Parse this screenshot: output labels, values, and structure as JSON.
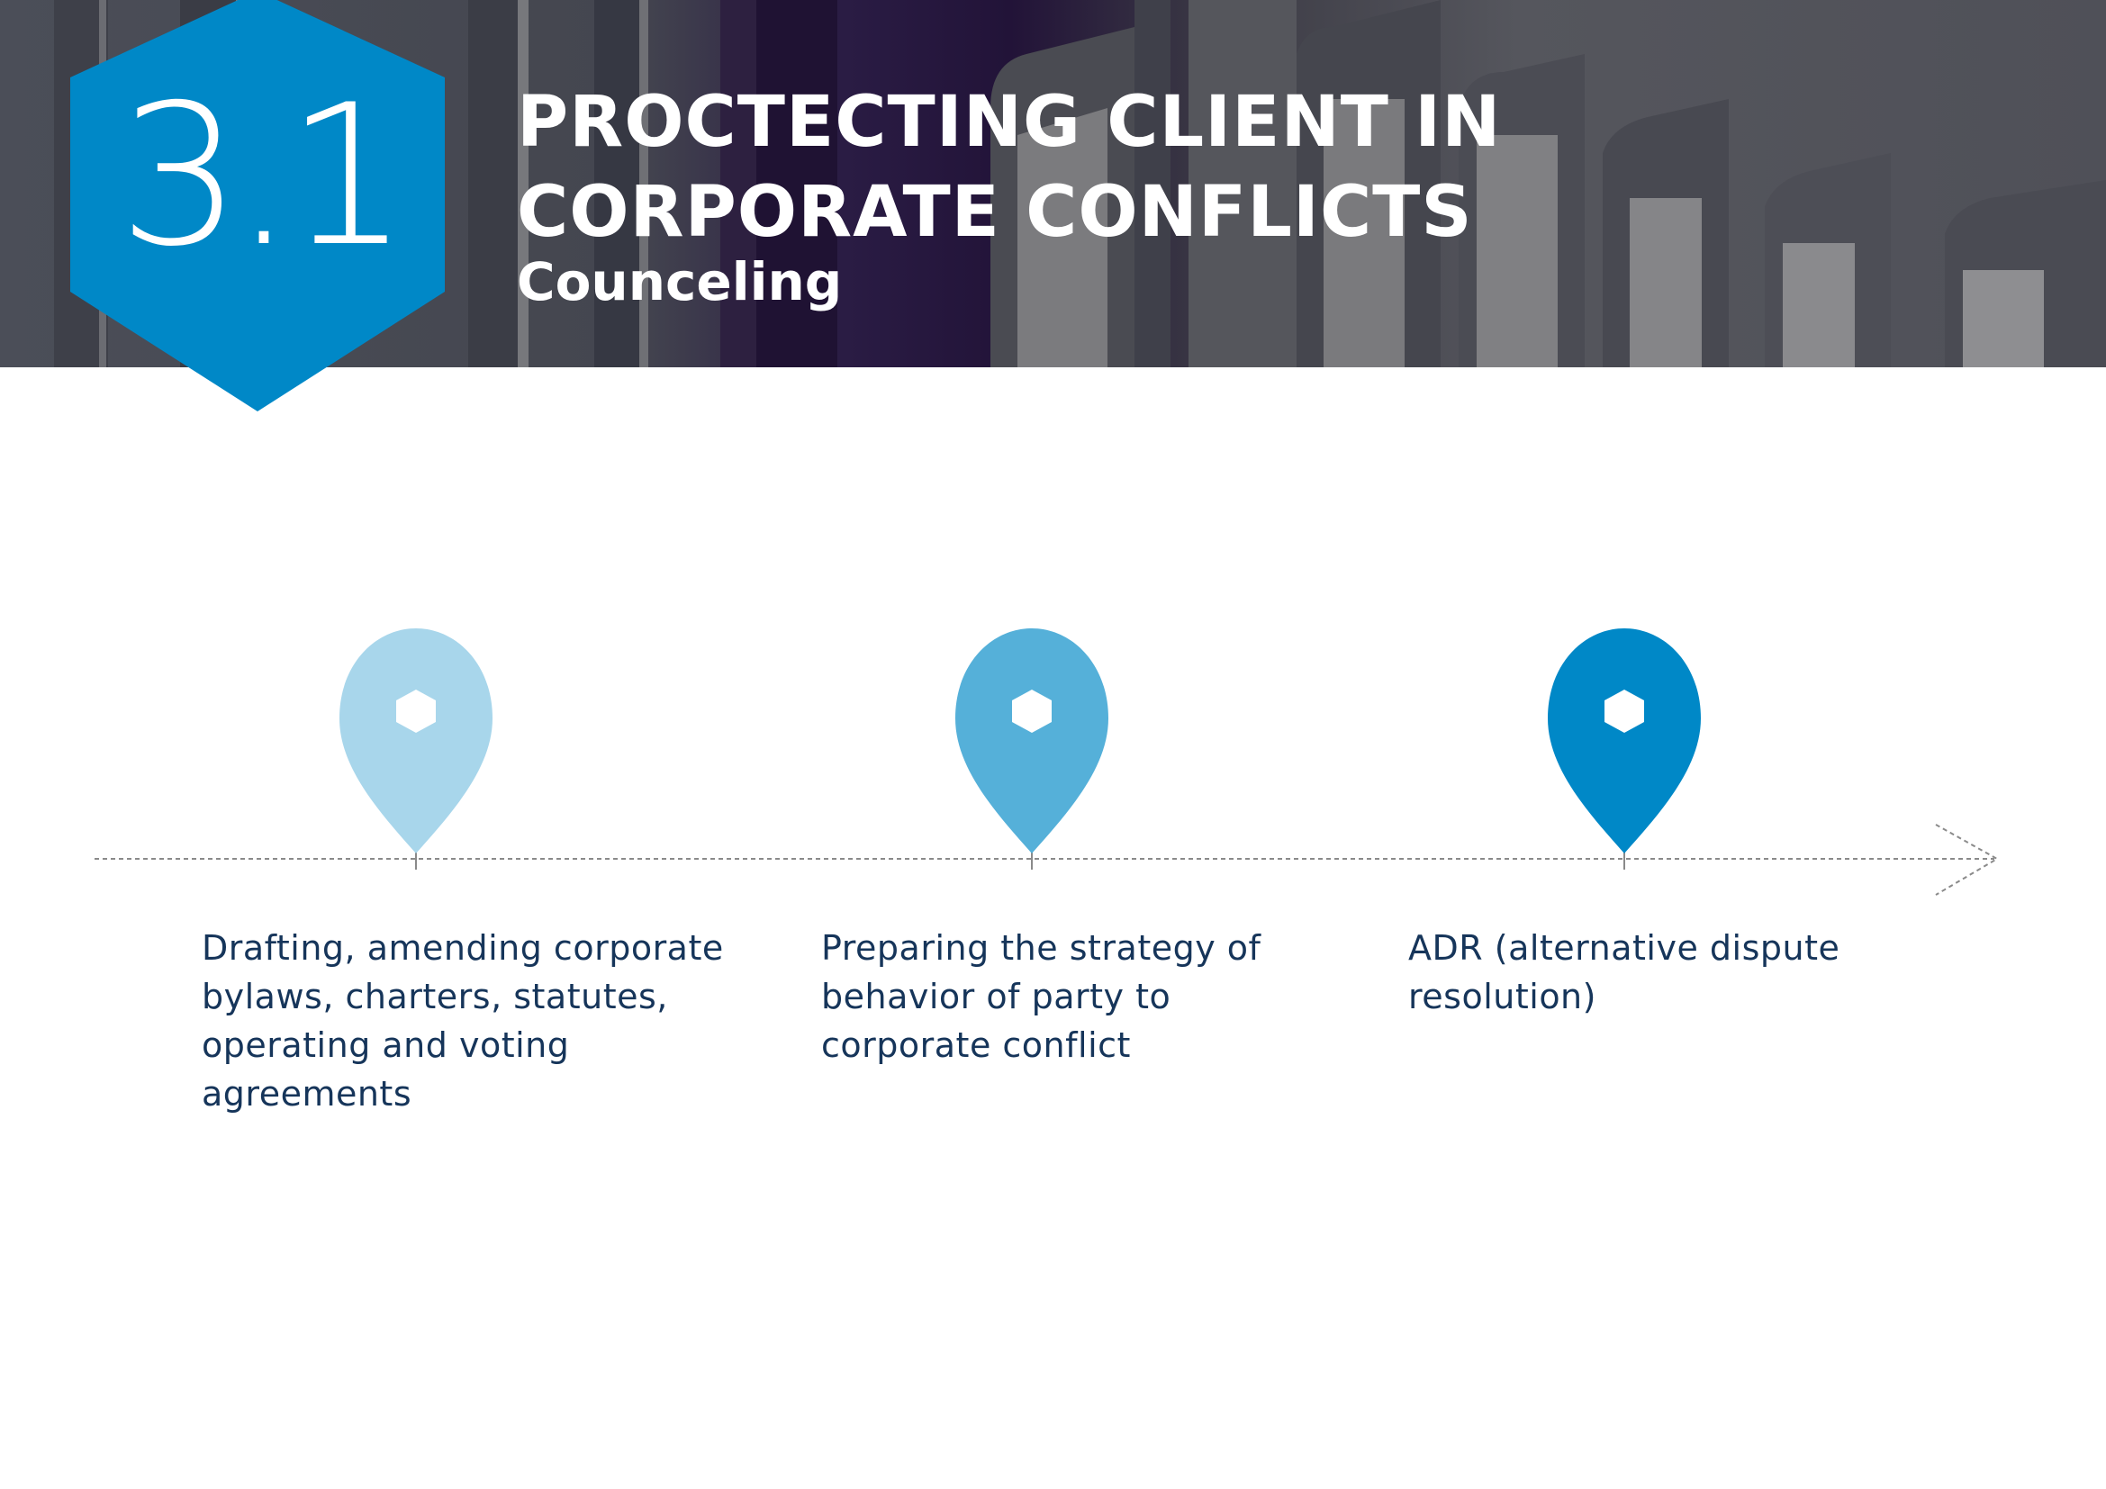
{
  "section": {
    "number": "3.1",
    "title": "PROCTECTING CLIENT IN CORPORATE CONFLICTS",
    "subtitle": "Counceling"
  },
  "colors": {
    "badge": "#0088c7",
    "pin_light": "#a8d6eb",
    "pin_medium": "#55b0d9",
    "pin_dark": "#0088c7",
    "text": "#16355a",
    "timeline_line": "#8a8a8a"
  },
  "timeline": {
    "steps": [
      {
        "text": "Drafting, amending corporate bylaws, charters, statutes, operating and voting agreements",
        "icon": "location-pin-icon"
      },
      {
        "text": "Preparing the strategy of behavior of party to corporate conflict",
        "icon": "location-pin-icon"
      },
      {
        "text": "ADR (alternative dispute resolution)",
        "icon": "location-pin-icon"
      }
    ]
  }
}
